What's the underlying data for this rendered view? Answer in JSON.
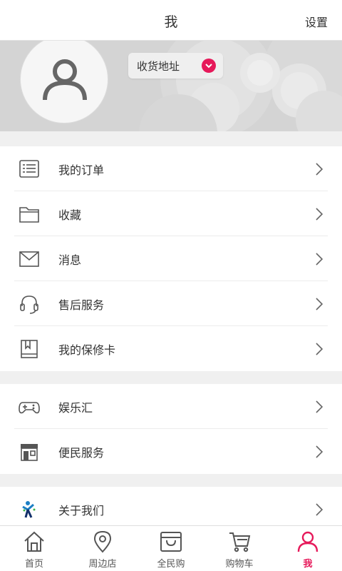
{
  "header": {
    "title": "我",
    "settings_label": "设置"
  },
  "profile": {
    "address_button_label": "收货地址"
  },
  "menu_group_1": [
    {
      "label": "我的订单",
      "icon": "order-list-icon"
    },
    {
      "label": "收藏",
      "icon": "folder-icon"
    },
    {
      "label": "消息",
      "icon": "mail-icon"
    },
    {
      "label": "售后服务",
      "icon": "headset-icon"
    },
    {
      "label": "我的保修卡",
      "icon": "book-icon"
    }
  ],
  "menu_group_2": [
    {
      "label": "娱乐汇",
      "icon": "gamepad-icon"
    },
    {
      "label": "便民服务",
      "icon": "store-icon"
    }
  ],
  "menu_group_3": [
    {
      "label": "关于我们",
      "icon": "about-logo-icon"
    }
  ],
  "tabbar": [
    {
      "label": "首页",
      "icon": "home-icon"
    },
    {
      "label": "周边店",
      "icon": "location-icon"
    },
    {
      "label": "全民购",
      "icon": "shopping-bag-icon"
    },
    {
      "label": "购物车",
      "icon": "cart-icon"
    },
    {
      "label": "我",
      "icon": "user-icon",
      "active": true
    }
  ],
  "colors": {
    "accent": "#e6195a",
    "background": "#f0f0f0",
    "banner": "#d4d4d4"
  }
}
